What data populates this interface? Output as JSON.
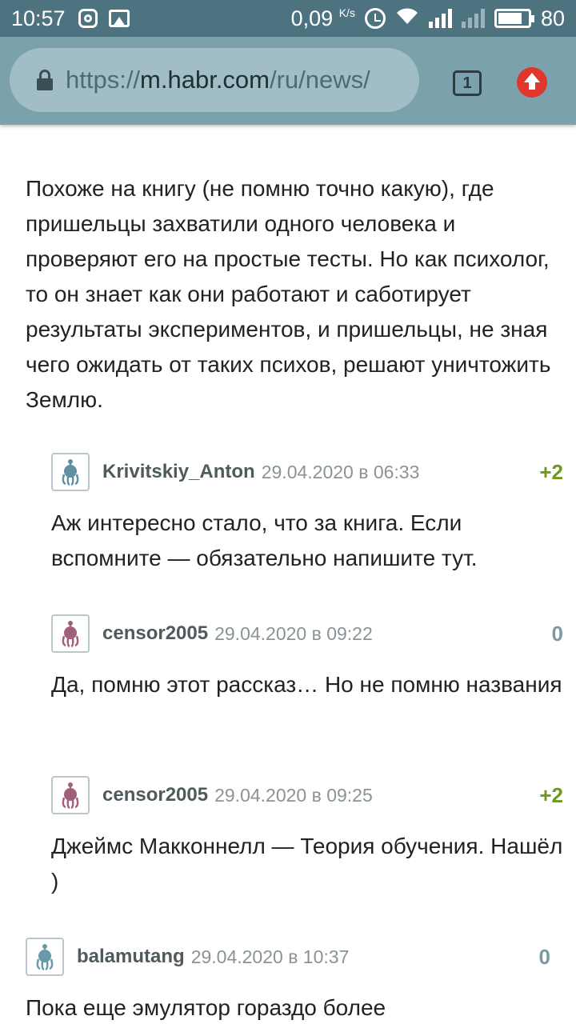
{
  "status_bar": {
    "time": "10:57",
    "speed": "0,09",
    "speed_unit": "K/s",
    "battery": "80",
    "icons": [
      "instagram-icon",
      "gallery-icon",
      "alarm-icon",
      "wifi-icon",
      "signal-icon",
      "battery-icon"
    ]
  },
  "browser": {
    "url_scheme": "https://",
    "url_host": "m.habr.com",
    "url_path": "/ru/news/",
    "tab_count": "1",
    "accent_color": "#e0362b",
    "toolbar_color": "#7aa1ac"
  },
  "post": {
    "text": "Похоже на книгу (не помню точно какую), где пришельцы захватили одного человека и проверяют его на простые тесты. Но как психолог, то он знает как они работают и саботирует результаты экспериментов, и пришельцы, не зная чего ожидать от таких психов, решают уничтожить Землю."
  },
  "comments": [
    {
      "author": "Krivitskiy_Anton",
      "date": "29.04.2020 в 06:33",
      "score": "+2",
      "avatar_color": "#5f8fa0",
      "text": "Аж интересно стало, что за книга. Если вспомните — обязательно напишите тут."
    },
    {
      "author": "censor2005",
      "date": "29.04.2020 в 09:22",
      "score": "0",
      "avatar_color": "#a0607a",
      "text": "Да, помню этот рассказ… Но не помню названия"
    },
    {
      "author": "censor2005",
      "date": "29.04.2020 в 09:25",
      "score": "+2",
      "avatar_color": "#a0607a",
      "text": "Джеймс Макконнелл — Теория обучения. Нашёл )"
    },
    {
      "author": "balamutang",
      "date": "29.04.2020 в 10:37",
      "score": "0",
      "avatar_color": "#6a9aa8",
      "text": "Пока еще эмулятор гораздо более"
    }
  ]
}
